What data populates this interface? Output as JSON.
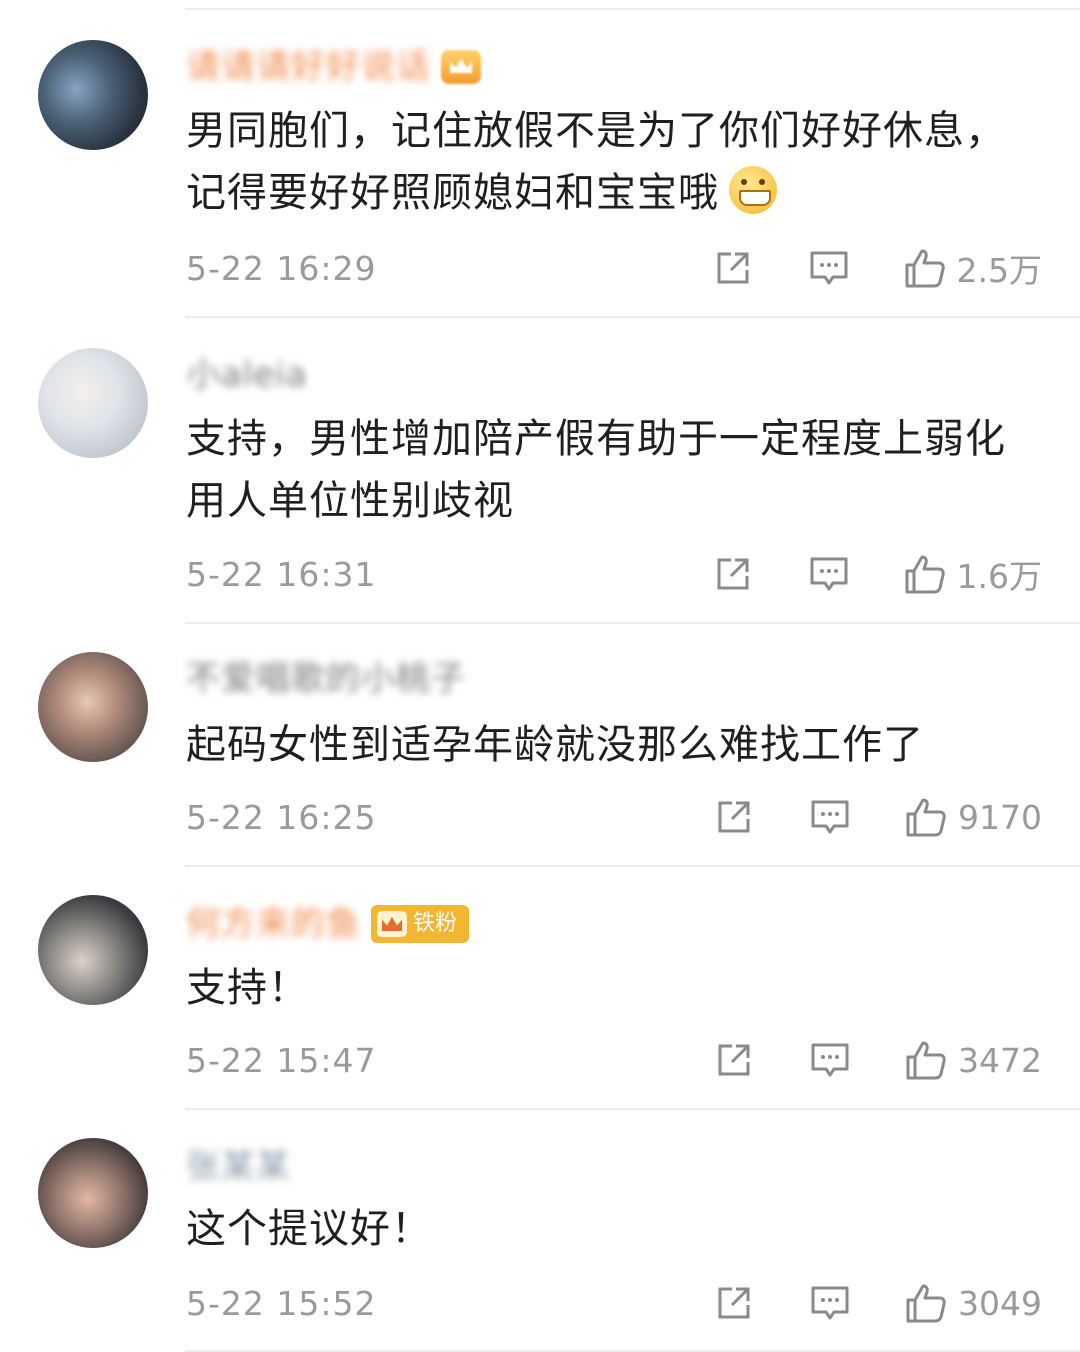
{
  "comments": [
    {
      "username": "请请请好好说话",
      "has_crown": true,
      "badge": "",
      "text": "男同胞们，记住放假不是为了你们好好休息，记得要好好照顾媳妇和宝宝哦",
      "emoji_icon": "grinning-emoji-icon",
      "time": "5-22 16:29",
      "likes": "2.5万"
    },
    {
      "username": "小aleia",
      "has_crown": false,
      "badge": "",
      "text": "支持，男性增加陪产假有助于一定程度上弱化用人单位性别歧视",
      "time": "5-22 16:31",
      "likes": "1.6万"
    },
    {
      "username": "不爱唱歌的小桃子",
      "has_crown": false,
      "badge": "",
      "text": "起码女性到适孕年龄就没那么难找工作了",
      "time": "5-22 16:25",
      "likes": "9170"
    },
    {
      "username": "何方来的鱼",
      "has_crown": false,
      "badge": "铁粉",
      "text": "支持！",
      "time": "5-22 15:47",
      "likes": "3472"
    },
    {
      "username": "张某某",
      "has_crown": false,
      "badge": "",
      "text": "这个提议好！",
      "time": "5-22 15:52",
      "likes": "3049"
    }
  ],
  "icons": {
    "share": "share-icon",
    "reply": "comment-icon",
    "like": "thumbs-up-icon"
  },
  "colors": {
    "username_orange": "#f08a4b",
    "meta_gray": "#9a9a9a",
    "badge_gold": "#f2b632"
  }
}
